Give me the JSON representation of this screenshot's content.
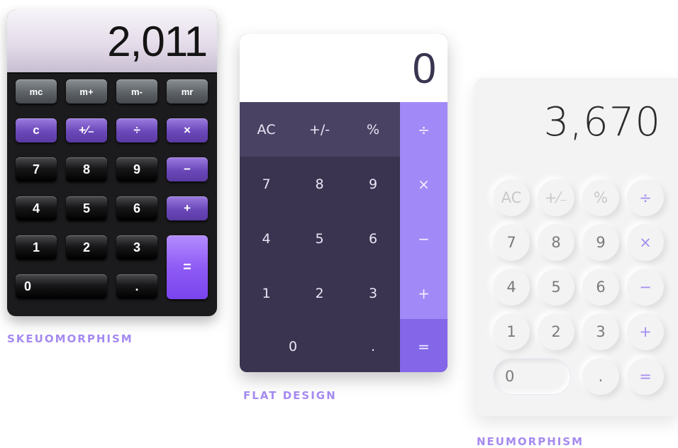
{
  "skeuomorphism": {
    "caption": "SKEUOMORPHISM",
    "display": "2,011",
    "buttons": {
      "mc": "mc",
      "mplus": "m+",
      "mminus": "m-",
      "mr": "mr",
      "c": "c",
      "plusminus": "+⁄₋",
      "divide": "÷",
      "multiply": "×",
      "n7": "7",
      "n8": "8",
      "n9": "9",
      "minus": "−",
      "n4": "4",
      "n5": "5",
      "n6": "6",
      "plus": "+",
      "n1": "1",
      "n2": "2",
      "n3": "3",
      "n0": "0",
      "dot": ".",
      "equals": "="
    }
  },
  "flat": {
    "caption": "FLAT DESIGN",
    "display": "0",
    "buttons": {
      "ac": "AC",
      "plusminus": "+/-",
      "percent": "%",
      "divide": "÷",
      "n7": "7",
      "n8": "8",
      "n9": "9",
      "multiply": "×",
      "n4": "4",
      "n5": "5",
      "n6": "6",
      "minus": "−",
      "n1": "1",
      "n2": "2",
      "n3": "3",
      "plus": "+",
      "n0": "0",
      "dot": ".",
      "equals": "="
    }
  },
  "neumorphism": {
    "caption": "NEUMORPHISM",
    "display": "3,670",
    "buttons": {
      "ac": "AC",
      "plusminus": "+⁄₋",
      "percent": "%",
      "divide": "÷",
      "n7": "7",
      "n8": "8",
      "n9": "9",
      "multiply": "×",
      "n4": "4",
      "n5": "5",
      "n6": "6",
      "minus": "−",
      "n1": "1",
      "n2": "2",
      "n3": "3",
      "plus": "+",
      "n0": "0",
      "dot": ".",
      "equals": "="
    }
  },
  "colors": {
    "accent": "#a58af0",
    "flat_dark": "#3b3451",
    "flat_op": "#a18af7",
    "skeuo_purple": "#6a48b8"
  }
}
